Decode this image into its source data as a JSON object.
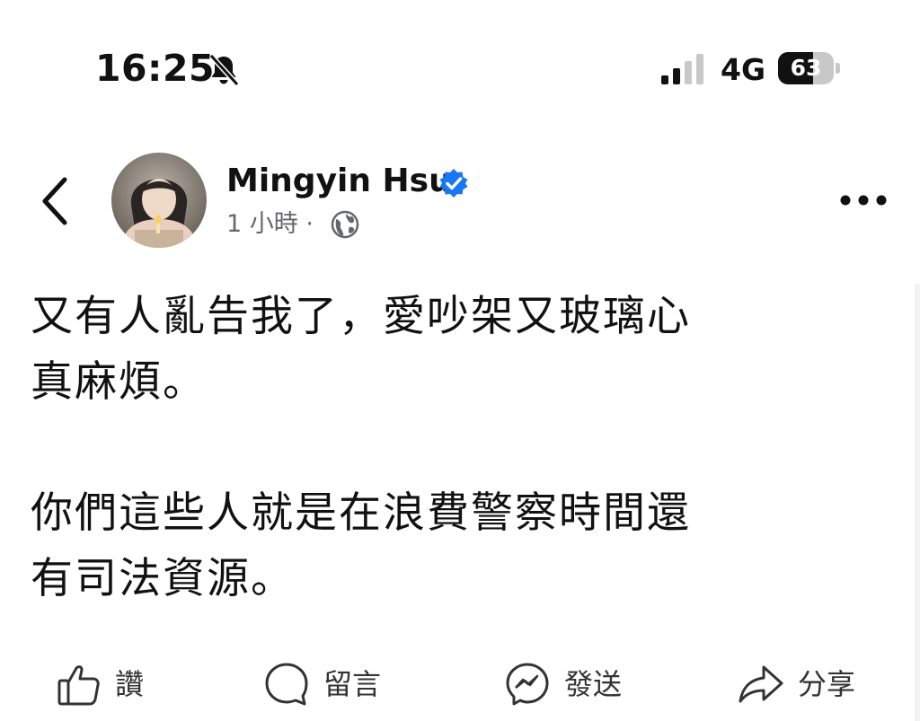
{
  "status_bar": {
    "time": "16:25",
    "bell_icon": "bell-slash-icon",
    "network": "4G",
    "battery_level": 63,
    "battery_text": "63"
  },
  "post": {
    "author": "Mingyin Hsu",
    "timestamp": "1 小時",
    "separator": "·",
    "audience_icon": "globe-icon",
    "text": "又有人亂告我了，愛吵架又玻璃心\n真麻煩。\n\n你們這些人就是在浪費警察時間還\n有司法資源。"
  },
  "actions": {
    "like": "讚",
    "comment": "留言",
    "send": "發送",
    "share": "分享"
  },
  "colors": {
    "verified": "#1877f2",
    "text": "#111111",
    "meta": "#65676b"
  }
}
